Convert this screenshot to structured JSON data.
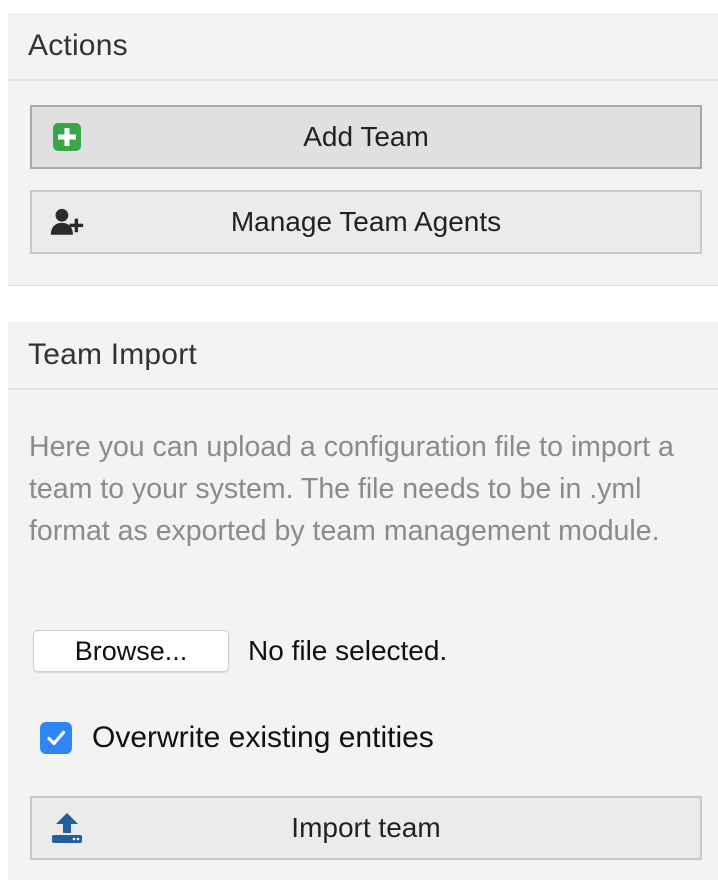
{
  "actions": {
    "title": "Actions",
    "add_team_label": "Add Team",
    "manage_agents_label": "Manage Team Agents"
  },
  "team_import": {
    "title": "Team Import",
    "description": "Here you can upload a configuration file to import a team to your system. The file needs to be in .yml format as exported by team management module.",
    "browse_label": "Browse...",
    "file_status": "No file selected.",
    "overwrite_label": "Overwrite existing entities",
    "overwrite_checked": true,
    "import_label": "Import team"
  },
  "icons": {
    "add": "plus-square-icon",
    "agents": "user-plus-icon",
    "import": "upload-icon",
    "checkmark": "checkmark-icon"
  },
  "colors": {
    "add_icon_green": "#3aa64a",
    "checkbox_blue": "#2f86f6",
    "import_icon_blue": "#1f5f9a"
  }
}
